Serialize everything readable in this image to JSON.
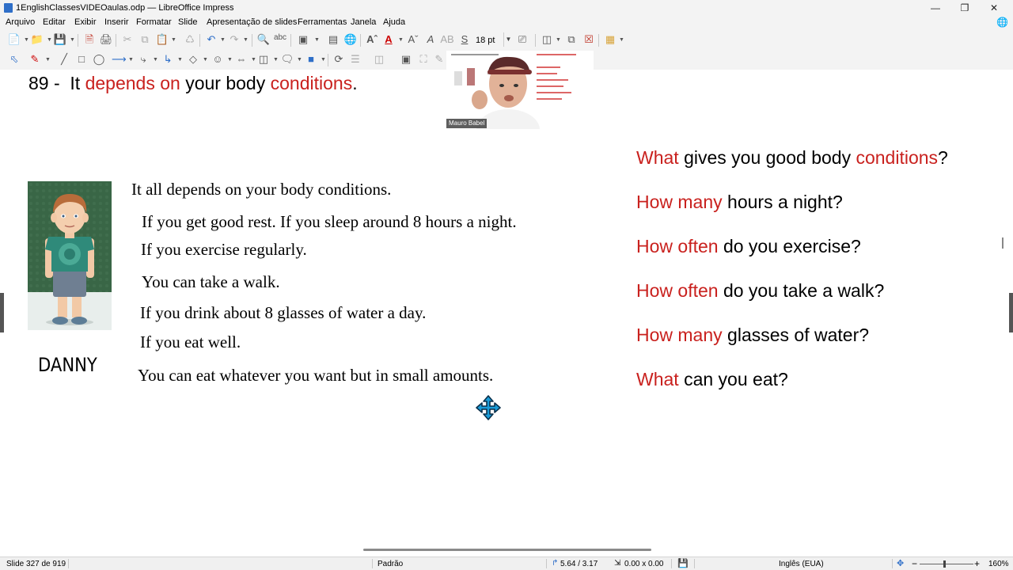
{
  "window": {
    "title": "1EnglishClassesVIDEOaulas.odp — LibreOffice Impress",
    "minimize_icon": "minimize-icon",
    "maximize_icon": "maximize-icon",
    "close_icon": "close-icon"
  },
  "menu": {
    "items": [
      "Arquivo",
      "Editar",
      "Exibir",
      "Inserir",
      "Formatar",
      "Slide",
      "Apresentação de slides",
      "Ferramentas",
      "Janela",
      "Ajuda"
    ]
  },
  "toolbar": {
    "font_size": "18 pt"
  },
  "slide": {
    "title": {
      "number": "89 -  ",
      "part1": "It ",
      "part2": "depends on",
      "part3": " your body ",
      "part4": "conditions",
      "part5": "."
    },
    "caption": "DANNY",
    "lines": [
      "It all depends on your body conditions.",
      "If you get good rest. If you sleep around 8 hours a night.",
      "If you exercise regularly.",
      "You can take a walk.",
      "If you drink about 8 glasses of water a day.",
      "If you eat well.",
      "You can eat whatever you want but in small amounts."
    ],
    "questions": [
      {
        "red": "What",
        "black": " gives you good body ",
        "red2": "conditions",
        "end": "?"
      },
      {
        "red": "How many",
        "black": " hours a night?"
      },
      {
        "red": "How often",
        "black": " do you exercise?"
      },
      {
        "red": "How often",
        "black": " do you take a walk?"
      },
      {
        "red": "How many",
        "black": " glasses of water?"
      },
      {
        "red": "What",
        "black": " can you eat?"
      }
    ]
  },
  "webcam": {
    "presenter_name": "Mauro Babel"
  },
  "status": {
    "slide_info": "Slide 327 de 919",
    "layout": "Padrão",
    "position": "5.64 / 3.17",
    "size": "0.00 x 0.00",
    "language": "Inglês (EUA)",
    "zoom": "160%"
  },
  "colors": {
    "accent_red": "#c9211e",
    "toolbar_bg": "#f3f3f3",
    "cursor_blue": "#1a9bd7"
  }
}
